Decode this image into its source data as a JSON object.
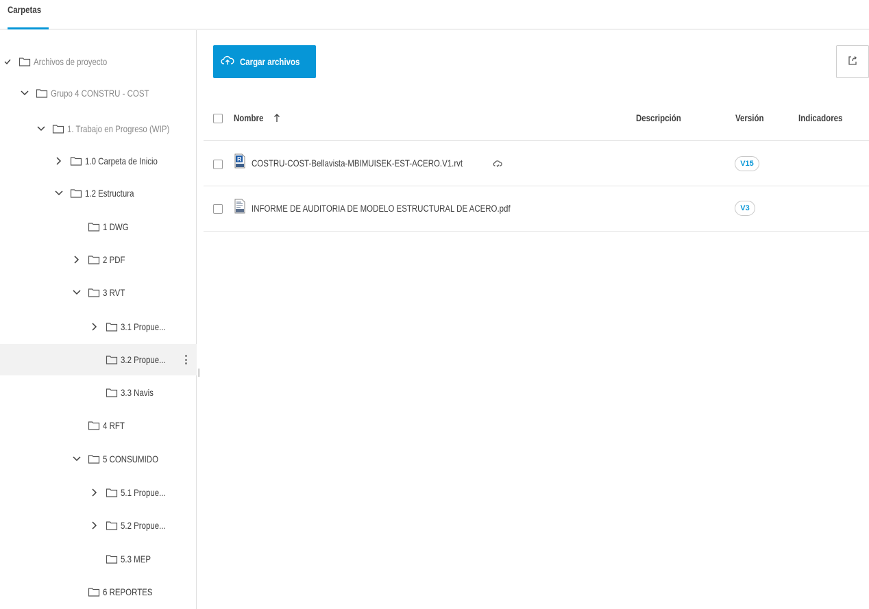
{
  "header": {
    "tab_label": "Carpetas"
  },
  "sidebar": {
    "items": [
      {
        "label": "Archivos de proyecto",
        "chevron": "check",
        "muted": true
      },
      {
        "label": "Grupo 4 CONSTRU - COST",
        "chevron": "down",
        "muted": true
      },
      {
        "label": "1. Trabajo en Progreso (WIP)",
        "chevron": "down",
        "muted": true
      },
      {
        "label": "1.0 Carpeta de Inicio",
        "chevron": "right",
        "muted": false
      },
      {
        "label": "1.2 Estructura",
        "chevron": "down",
        "muted": false
      },
      {
        "label": "1 DWG",
        "chevron": "none",
        "muted": false
      },
      {
        "label": "2 PDF",
        "chevron": "right",
        "muted": false
      },
      {
        "label": "3 RVT",
        "chevron": "down",
        "muted": false
      },
      {
        "label": "3.1 Propue...",
        "chevron": "right",
        "muted": false
      },
      {
        "label": "3.2 Propue...",
        "chevron": "none",
        "muted": false,
        "selected": true
      },
      {
        "label": "3.3 Navis",
        "chevron": "none",
        "muted": false
      },
      {
        "label": "4 RFT",
        "chevron": "none",
        "muted": false
      },
      {
        "label": "5 CONSUMIDO",
        "chevron": "down",
        "muted": false
      },
      {
        "label": "5.1 Propue...",
        "chevron": "right",
        "muted": false
      },
      {
        "label": "5.2 Propue...",
        "chevron": "right",
        "muted": false
      },
      {
        "label": "5.3 MEP",
        "chevron": "none",
        "muted": false
      },
      {
        "label": "6 REPORTES",
        "chevron": "none",
        "muted": false
      }
    ]
  },
  "toolbar": {
    "upload_label": "Cargar archivos"
  },
  "table": {
    "columns": {
      "name": "Nombre",
      "description": "Descripción",
      "version": "Versión",
      "flags": "Indicadores"
    },
    "rows": [
      {
        "name": "COSTRU-COST-Bellavista-MBIMUISEK-EST-ACERO.V1.rvt",
        "version": "V15",
        "type": "rvt-file-icon"
      },
      {
        "name": "INFORME DE AUDITORIA DE MODELO ESTRUCTURAL DE ACERO.pdf",
        "version": "V3",
        "type": "pdf-file-icon"
      }
    ]
  },
  "colors": {
    "accent": "#0696d7",
    "text": "#3c3c3c",
    "muted": "#8a8a8a",
    "selected_row": "#f2f2f2"
  }
}
